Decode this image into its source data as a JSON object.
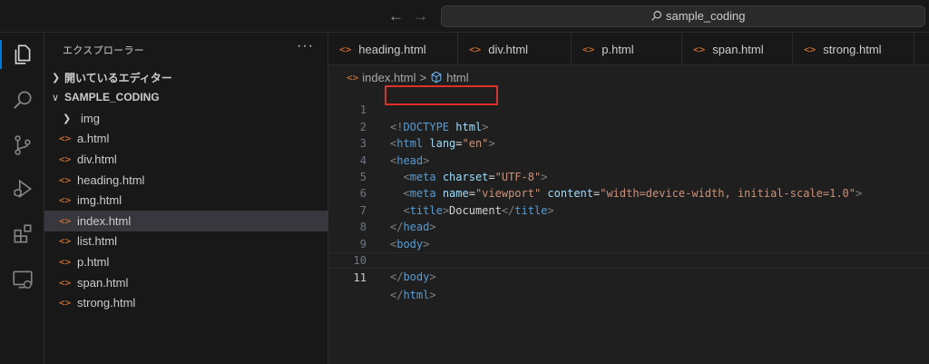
{
  "titlebar": {
    "back_icon": "arrow-left-icon",
    "forward_icon": "arrow-right-icon",
    "search_text": "sample_coding"
  },
  "activity_bar": {
    "items": [
      "explorer-icon",
      "search-icon",
      "source-control-icon",
      "run-debug-icon",
      "extensions-icon",
      "remote-explorer-icon"
    ]
  },
  "sidebar": {
    "title": "エクスプローラー",
    "more": "···",
    "open_editors": "開いているエディター",
    "folder": "SAMPLE_CODING",
    "items": [
      {
        "label": "img",
        "type": "folder"
      },
      {
        "label": "a.html",
        "type": "file"
      },
      {
        "label": "div.html",
        "type": "file"
      },
      {
        "label": "heading.html",
        "type": "file"
      },
      {
        "label": "img.html",
        "type": "file"
      },
      {
        "label": "index.html",
        "type": "file"
      },
      {
        "label": "list.html",
        "type": "file"
      },
      {
        "label": "p.html",
        "type": "file"
      },
      {
        "label": "span.html",
        "type": "file"
      },
      {
        "label": "strong.html",
        "type": "file"
      }
    ]
  },
  "tabs": [
    "heading.html",
    "div.html",
    "p.html",
    "span.html",
    "strong.html"
  ],
  "breadcrumb": {
    "file": "index.html",
    "sep": ">",
    "element": "html"
  },
  "code": {
    "line_numbers": [
      "1",
      "2",
      "3",
      "4",
      "5",
      "6",
      "7",
      "8",
      "9",
      "10",
      "11"
    ],
    "l1": {
      "a": "<!",
      "b": "DOCTYPE",
      "c": " html",
      "d": ">"
    },
    "l2": {
      "a": "<",
      "b": "html",
      "c": " lang",
      "d": "=",
      "e": "\"en\"",
      "f": ">"
    },
    "l3": {
      "a": "<",
      "b": "head",
      "c": ">"
    },
    "l4": {
      "indent": "  ",
      "a": "<",
      "b": "meta",
      "c": " charset",
      "d": "=",
      "e": "\"UTF-8\"",
      "f": ">"
    },
    "l5": {
      "indent": "  ",
      "a": "<",
      "b": "meta",
      "c": " name",
      "d": "=",
      "e": "\"viewport\"",
      "f": " content",
      "g": "=",
      "h": "\"width=device-width, initial-scale=1.0\"",
      "i": ">"
    },
    "l6": {
      "indent": "  ",
      "a": "<",
      "b": "title",
      "c": ">",
      "d": "Document",
      "e": "</",
      "f": "title",
      "g": ">"
    },
    "l7": {
      "a": "</",
      "b": "head",
      "c": ">"
    },
    "l8": {
      "a": "<",
      "b": "body",
      "c": ">"
    },
    "l10": {
      "a": "</",
      "b": "body",
      "c": ">"
    },
    "l11": {
      "a": "</",
      "b": "html",
      "c": ">"
    }
  },
  "colors": {
    "accent": "#0078d4",
    "highlight_box": "#e0302a",
    "tag": "#569cd6",
    "attribute": "#9cdcfe",
    "string": "#ce9178",
    "html_file_icon": "#e37933"
  }
}
